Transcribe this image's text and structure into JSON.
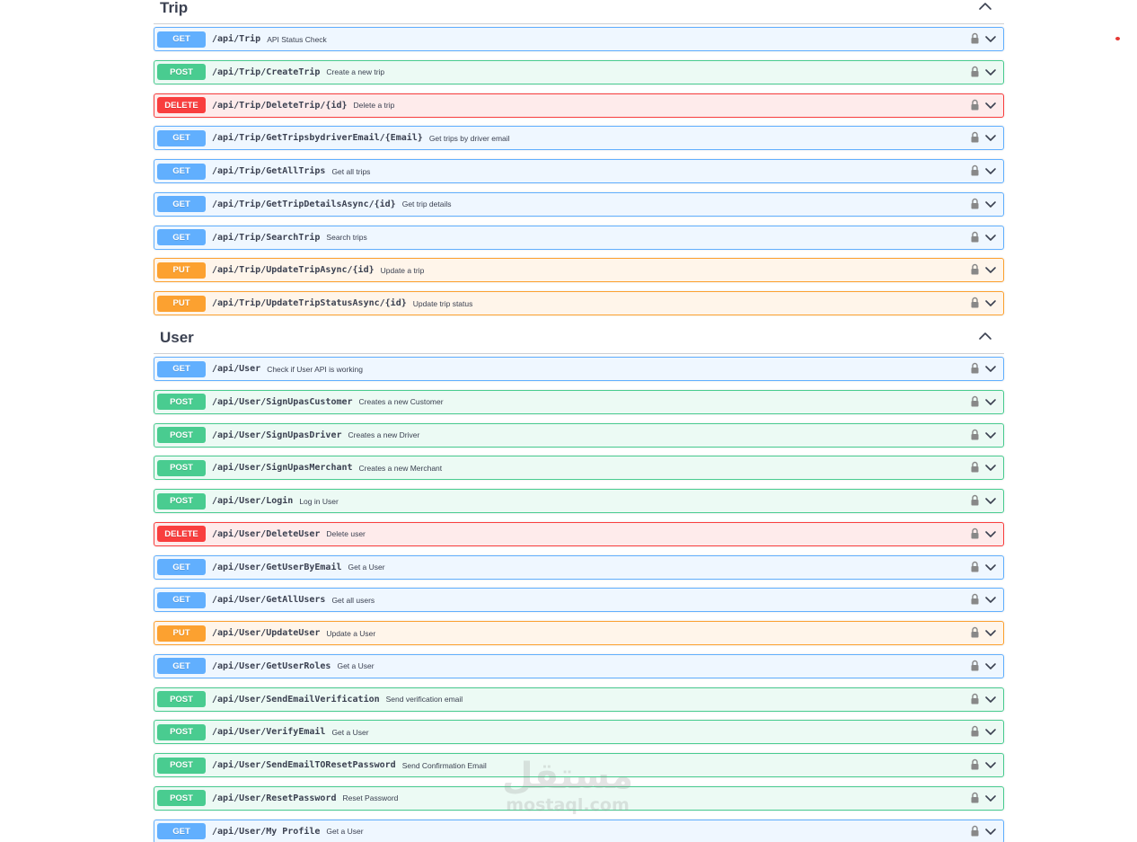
{
  "sections": [
    {
      "title": "Trip",
      "operations": [
        {
          "method": "GET",
          "path": "/api/Trip",
          "summary": "API Status Check"
        },
        {
          "method": "POST",
          "path": "/api/Trip/CreateTrip",
          "summary": "Create a new trip"
        },
        {
          "method": "DELETE",
          "path": "/api/Trip/DeleteTrip/{id}",
          "summary": "Delete a trip"
        },
        {
          "method": "GET",
          "path": "/api/Trip/GetTripsbydriverEmail/{Email}",
          "summary": "Get trips by driver email"
        },
        {
          "method": "GET",
          "path": "/api/Trip/GetAllTrips",
          "summary": "Get all trips"
        },
        {
          "method": "GET",
          "path": "/api/Trip/GetTripDetailsAsync/{id}",
          "summary": "Get trip details"
        },
        {
          "method": "GET",
          "path": "/api/Trip/SearchTrip",
          "summary": "Search trips"
        },
        {
          "method": "PUT",
          "path": "/api/Trip/UpdateTripAsync/{id}",
          "summary": "Update a trip"
        },
        {
          "method": "PUT",
          "path": "/api/Trip/UpdateTripStatusAsync/{id}",
          "summary": "Update trip status"
        }
      ]
    },
    {
      "title": "User",
      "operations": [
        {
          "method": "GET",
          "path": "/api/User",
          "summary": "Check if User API is working"
        },
        {
          "method": "POST",
          "path": "/api/User/SignUpasCustomer",
          "summary": "Creates a new Customer"
        },
        {
          "method": "POST",
          "path": "/api/User/SignUpasDriver",
          "summary": "Creates a new Driver"
        },
        {
          "method": "POST",
          "path": "/api/User/SignUpasMerchant",
          "summary": "Creates a new Merchant"
        },
        {
          "method": "POST",
          "path": "/api/User/Login",
          "summary": "Log in User"
        },
        {
          "method": "DELETE",
          "path": "/api/User/DeleteUser",
          "summary": "Delete user"
        },
        {
          "method": "GET",
          "path": "/api/User/GetUserByEmail",
          "summary": "Get a User"
        },
        {
          "method": "GET",
          "path": "/api/User/GetAllUsers",
          "summary": "Get all users"
        },
        {
          "method": "PUT",
          "path": "/api/User/UpdateUser",
          "summary": "Update a User"
        },
        {
          "method": "GET",
          "path": "/api/User/GetUserRoles",
          "summary": "Get a User"
        },
        {
          "method": "POST",
          "path": "/api/User/SendEmailVerification",
          "summary": "Send verification email"
        },
        {
          "method": "POST",
          "path": "/api/User/VerifyEmail",
          "summary": "Get a User"
        },
        {
          "method": "POST",
          "path": "/api/User/SendEmailTOResetPassword",
          "summary": "Send Confirmation Email"
        },
        {
          "method": "POST",
          "path": "/api/User/ResetPassword",
          "summary": "Reset Password"
        },
        {
          "method": "GET",
          "path": "/api/User/My Profile",
          "summary": "Get a User"
        }
      ]
    }
  ],
  "watermark": {
    "arabic": "مستقل",
    "latin": "mostaql.com"
  },
  "colors": {
    "get": "#61affe",
    "post": "#49cc90",
    "delete": "#f93e3e",
    "put": "#fca130",
    "text": "#3b4151"
  },
  "icons": {
    "lock": "lock-icon",
    "expand": "chevron-down-icon",
    "collapse": "chevron-up-icon"
  }
}
